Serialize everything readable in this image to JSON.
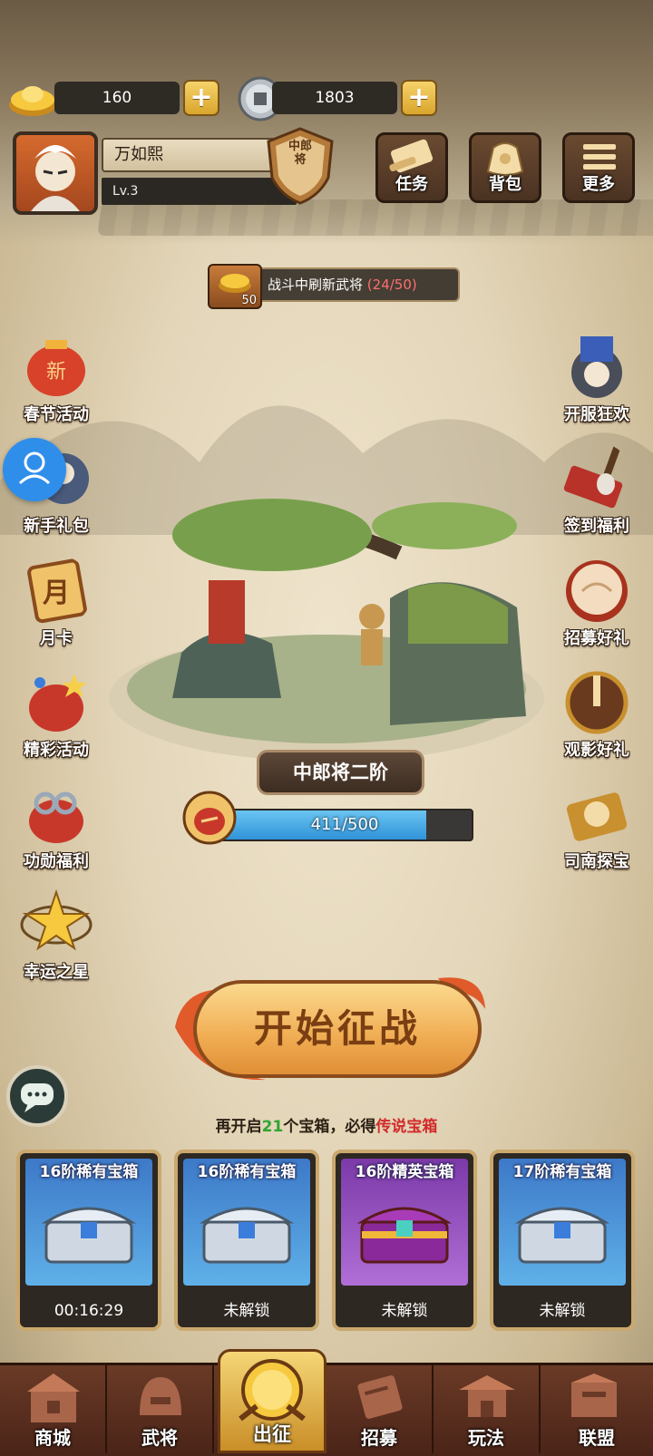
{
  "currency": {
    "gold": "160",
    "coins": "1803",
    "gold_icon": "gold-ingot-icon",
    "coin_icon": "copper-coin-icon"
  },
  "player": {
    "name": "万如熙",
    "level": "Lv.3",
    "rank_badge": "中郎将"
  },
  "top_buttons": [
    {
      "label": "任务",
      "icon": "scroll-icon"
    },
    {
      "label": "背包",
      "icon": "bag-icon"
    },
    {
      "label": "更多",
      "icon": "menu-icon"
    }
  ],
  "refresh_banner": {
    "text": "战斗中刷新武将",
    "progress": "(24/50)",
    "box_count": "50"
  },
  "left_menu": [
    {
      "label": "春节活动",
      "icon": "lantern-icon"
    },
    {
      "label": "新手礼包",
      "icon": "gift-icon"
    },
    {
      "label": "月卡",
      "icon": "month-card-icon",
      "glyph": "月"
    },
    {
      "label": "精彩活动",
      "icon": "treasure-bag-icon"
    },
    {
      "label": "功勋福利",
      "icon": "medal-bag-icon"
    },
    {
      "label": "幸运之星",
      "icon": "star-icon"
    }
  ],
  "right_menu": [
    {
      "label": "开服狂欢",
      "icon": "emperor-icon"
    },
    {
      "label": "签到福利",
      "icon": "brush-icon"
    },
    {
      "label": "招募好礼",
      "icon": "drum-icon"
    },
    {
      "label": "观影好礼",
      "icon": "film-reel-icon"
    },
    {
      "label": "司南探宝",
      "icon": "compass-icon"
    }
  ],
  "stage": {
    "name": "中郎将二阶",
    "progress_text": "411/500",
    "progress_value": 0.822
  },
  "start_button": "开始征战",
  "chest_hint": {
    "prefix": "再开启",
    "count": "21",
    "middle": "个宝箱，必得",
    "reward": "传说宝箱"
  },
  "chests": [
    {
      "title": "16阶稀有宝箱",
      "status": "00:16:29",
      "color": "blue"
    },
    {
      "title": "16阶稀有宝箱",
      "status": "未解锁",
      "color": "blue"
    },
    {
      "title": "16阶精英宝箱",
      "status": "未解锁",
      "color": "purple"
    },
    {
      "title": "17阶稀有宝箱",
      "status": "未解锁",
      "color": "blue"
    }
  ],
  "nav": [
    {
      "label": "商城",
      "icon": "shop-icon"
    },
    {
      "label": "武将",
      "icon": "helmet-icon"
    },
    {
      "label": "出征",
      "icon": "battle-icon"
    },
    {
      "label": "招募",
      "icon": "recruit-scroll-icon"
    },
    {
      "label": "玩法",
      "icon": "pavilion-icon"
    },
    {
      "label": "联盟",
      "icon": "alliance-icon"
    }
  ],
  "colors": {
    "accent_gold": "#f0ac52",
    "progress_blue": "#2f93d8",
    "hint_green": "#2fa533",
    "hint_red": "#d12b2b"
  }
}
